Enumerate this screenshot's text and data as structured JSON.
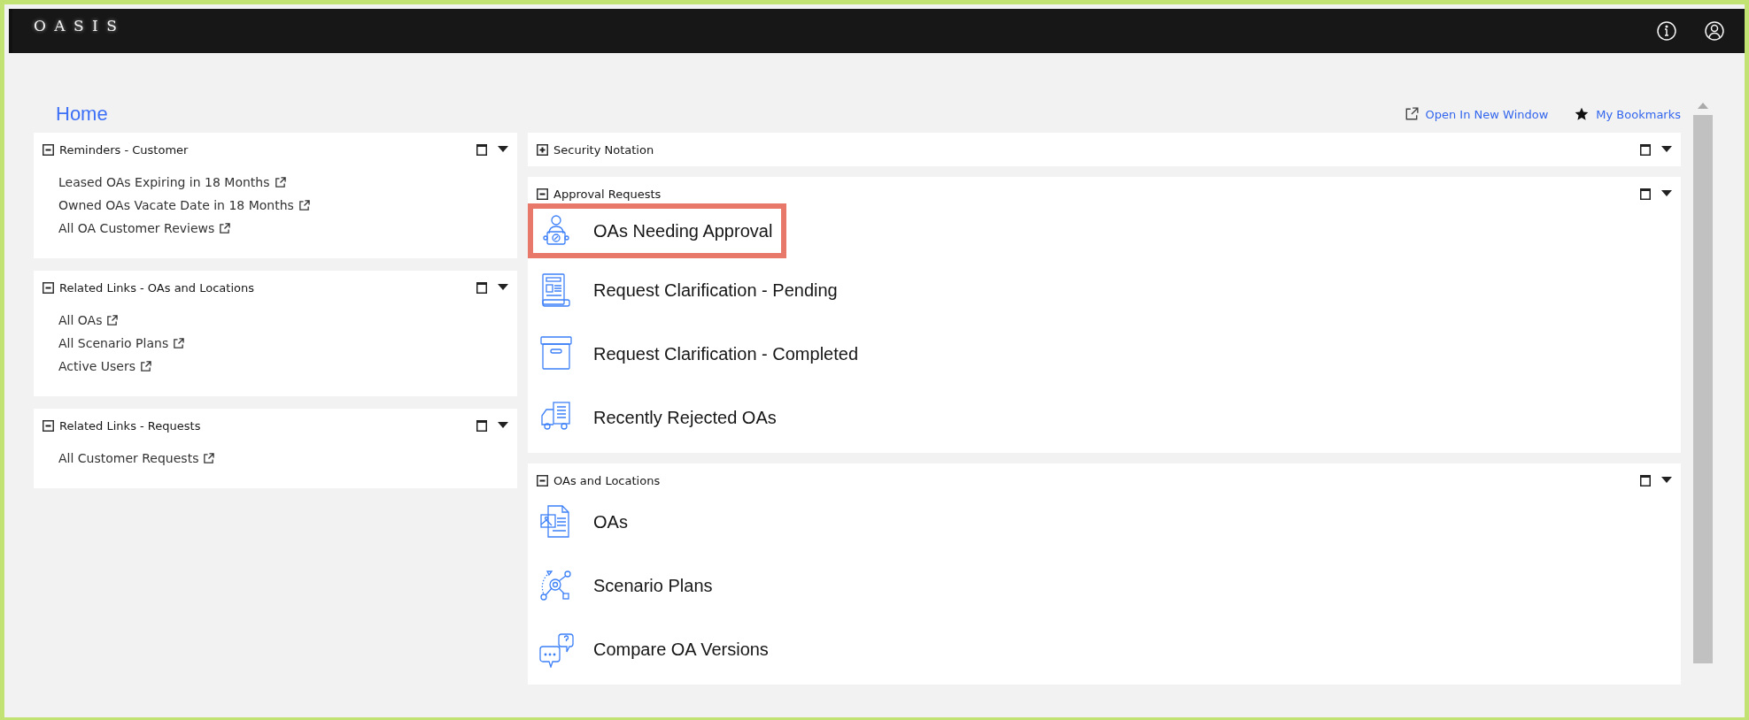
{
  "app": {
    "logo": "O A S I S"
  },
  "page": {
    "title": "Home",
    "actions": [
      {
        "kind": "external",
        "label": "Open In New Window"
      },
      {
        "kind": "star",
        "label": "My Bookmarks"
      }
    ]
  },
  "left_panels": [
    {
      "title": "Reminders - Customer",
      "expanded": true,
      "links": [
        "Leased OAs Expiring in 18 Months",
        "Owned OAs Vacate Date in 18 Months",
        "All OA Customer Reviews"
      ]
    },
    {
      "title": "Related Links - OAs and Locations",
      "expanded": true,
      "links": [
        "All OAs",
        "All Scenario Plans",
        "Active Users"
      ]
    },
    {
      "title": "Related Links - Requests",
      "expanded": true,
      "links": [
        "All Customer Requests"
      ]
    }
  ],
  "main_panels": [
    {
      "title": "Security Notation",
      "expanded": false
    },
    {
      "title": "Approval Requests",
      "expanded": true,
      "items": [
        {
          "kind": "person",
          "label": "OAs Needing Approval",
          "highlighted": true
        },
        {
          "kind": "form",
          "label": "Request Clarification - Pending",
          "highlighted": false
        },
        {
          "kind": "box",
          "label": "Request Clarification - Completed",
          "highlighted": false
        },
        {
          "kind": "truck",
          "label": "Recently Rejected OAs",
          "highlighted": false
        }
      ]
    },
    {
      "title": "OAs and Locations",
      "expanded": true,
      "items": [
        {
          "kind": "imagedoc",
          "label": "OAs",
          "highlighted": false
        },
        {
          "kind": "network",
          "label": "Scenario Plans",
          "highlighted": false
        },
        {
          "kind": "chat",
          "label": "Compare OA Versions",
          "highlighted": false
        }
      ]
    }
  ]
}
